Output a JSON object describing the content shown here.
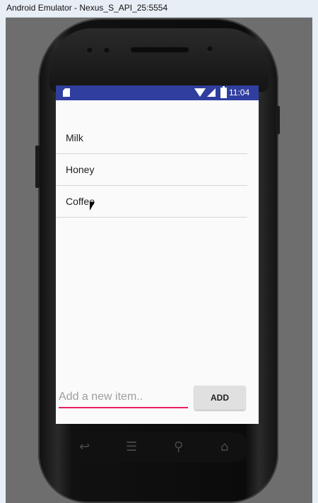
{
  "window": {
    "title": "Android Emulator - Nexus_S_API_25:5554"
  },
  "status_bar": {
    "time": "11:04",
    "icons": [
      "sd-card-icon",
      "wifi-icon",
      "cell-signal-icon",
      "battery-icon"
    ],
    "color": "#303f9f"
  },
  "list": {
    "items": [
      "Milk",
      "Honey",
      "Coffee"
    ]
  },
  "input": {
    "placeholder": "Add a new item..",
    "value": "",
    "accent_color": "#e91e63"
  },
  "add_button": {
    "label": "ADD"
  },
  "nav_bar": {
    "icons": [
      "back-icon",
      "menu-icon",
      "search-icon",
      "home-icon"
    ]
  }
}
